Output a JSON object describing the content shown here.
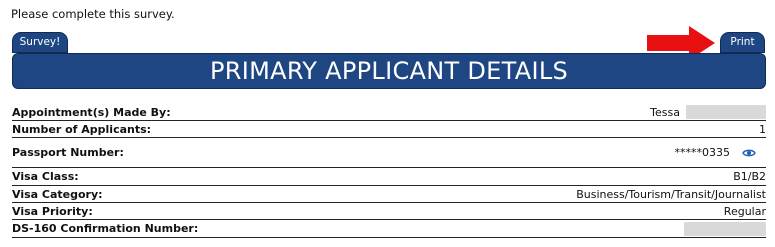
{
  "survey": {
    "prompt": "Please complete this survey.",
    "button_label": "Survey!"
  },
  "toolbar": {
    "print_label": "Print"
  },
  "banner": {
    "title": "PRIMARY APPLICANT DETAILS"
  },
  "colors": {
    "primary": "#1e4682",
    "arrow": "#e81010",
    "redaction": "#d9d9d9"
  },
  "details": {
    "rows": [
      {
        "label": "Appointment(s) Made By:",
        "value": "Tessa"
      },
      {
        "label": "Number of Applicants:",
        "value": "1"
      },
      {
        "label": "Passport Number:",
        "value": "*****0335"
      },
      {
        "label": "Visa Class:",
        "value": "B1/B2"
      },
      {
        "label": "Visa Category:",
        "value": "Business/Tourism/Transit/Journalist"
      },
      {
        "label": "Visa Priority:",
        "value": "Regular"
      },
      {
        "label": "DS-160 Confirmation Number:",
        "value": ""
      }
    ]
  }
}
